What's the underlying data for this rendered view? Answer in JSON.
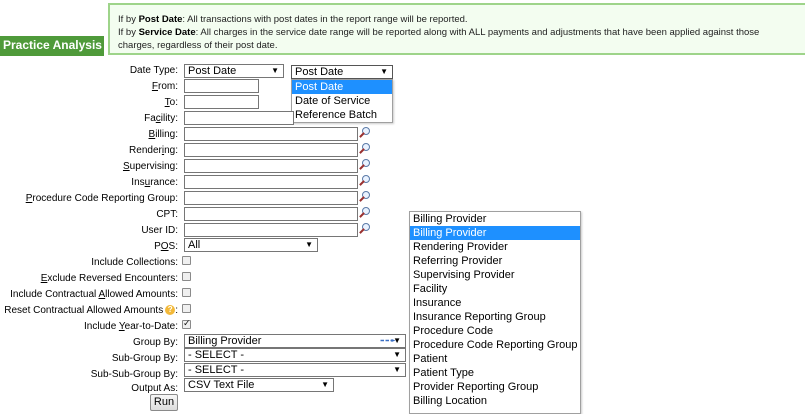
{
  "page": {
    "title": "Practice Analysis"
  },
  "tooltip": {
    "line1_prefix": "If by ",
    "line1_bold": "Post Date",
    "line1_rest": ": All transactions with post dates in the report range will be reported.",
    "line2_prefix": "If by ",
    "line2_bold": "Service Date",
    "line2_rest": ": All charges in the service date range will be reported along with ALL payments and adjustments that have been applied against those",
    "line3": "charges, regardless of their post date."
  },
  "form": {
    "date_type": {
      "label": "Date Type:",
      "value": "Post Date"
    },
    "date_type_open": {
      "value": "Post Date",
      "options": [
        "Post Date",
        "Date of Service",
        "Reference Batch"
      ],
      "highlighted": 0
    },
    "from": {
      "label": "From:",
      "value": ""
    },
    "to": {
      "label": "To:",
      "value": ""
    },
    "facility": {
      "label": "Facility:",
      "value": ""
    },
    "billing": {
      "label": "Billing:",
      "value": ""
    },
    "rendering": {
      "label": "Rendering:",
      "value": ""
    },
    "supervising": {
      "label": "Supervising:",
      "value": ""
    },
    "insurance": {
      "label": "Insurance:",
      "value": ""
    },
    "pcrg": {
      "label": "Procedure Code Reporting Group:",
      "value": ""
    },
    "cpt": {
      "label": "CPT:",
      "value": ""
    },
    "user_id": {
      "label": "User ID:",
      "value": ""
    },
    "pos": {
      "label": "POS:",
      "value": "All"
    },
    "include_collections": {
      "label": "Include Collections:",
      "checked": false
    },
    "exclude_reversed": {
      "label": "Exclude Reversed Encounters:",
      "checked": false
    },
    "include_contractual": {
      "label": "Include Contractual Allowed Amounts:",
      "checked": false
    },
    "reset_contractual": {
      "label": "Reset Contractual Allowed Amounts",
      "help": "?",
      "checked": false
    },
    "include_ytd": {
      "label": "Include Year-to-Date:",
      "checked": true
    },
    "group_by": {
      "label": "Group By:",
      "value": "Billing Provider"
    },
    "sub_group_by": {
      "label": "Sub-Group By:",
      "value": "- SELECT -"
    },
    "sub_sub_group_by": {
      "label": "Sub-Sub-Group By:",
      "value": "- SELECT -"
    },
    "output_as": {
      "label": "Output As:",
      "value": "CSV Text File"
    },
    "run_label": "Run"
  },
  "group_by_list": {
    "options": [
      "Billing Provider",
      "Billing Provider",
      "Rendering Provider",
      "Referring Provider",
      "Supervising Provider",
      "Facility",
      "Insurance",
      "Insurance Reporting Group",
      "Procedure Code",
      "Procedure Code Reporting Group",
      "Patient",
      "Patient Type",
      "Provider Reporting Group",
      "Billing Location"
    ],
    "highlighted": 1
  },
  "colors": {
    "title_bg": "#4f9a3a",
    "tooltip_bg": "#f3fdf0",
    "tooltip_border": "#9ed48a",
    "highlight": "#1e90ff",
    "arrow": "#3a6fc4"
  }
}
